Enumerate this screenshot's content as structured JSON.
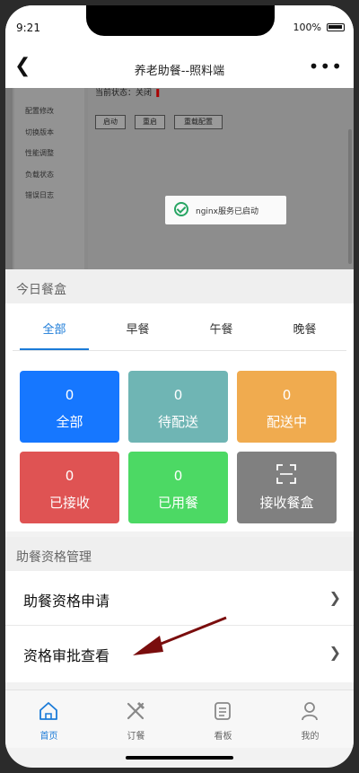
{
  "status_bar": {
    "time": "9:21",
    "battery": "100%"
  },
  "nav": {
    "title": "养老助餐--照料端"
  },
  "embedded_screenshot": {
    "side_menu": [
      "配置修改",
      "切换版本",
      "性能调整",
      "负载状态",
      "错误日志"
    ],
    "status_label": "当前状态：关闭",
    "buttons": [
      "启动",
      "重启",
      "重载配置"
    ],
    "toast": "nginx服务已启动"
  },
  "today_meals": {
    "section_title": "今日餐盒",
    "tabs": [
      "全部",
      "早餐",
      "午餐",
      "晚餐"
    ],
    "active_tab": "全部",
    "tiles": [
      {
        "count": "0",
        "label": "全部",
        "color": "#1677ff"
      },
      {
        "count": "0",
        "label": "待配送",
        "color": "#6fb5b4"
      },
      {
        "count": "0",
        "label": "配送中",
        "color": "#f0ab4f"
      },
      {
        "count": "0",
        "label": "已接收",
        "color": "#df5353"
      },
      {
        "count": "0",
        "label": "已用餐",
        "color": "#4cd964"
      },
      {
        "count": "",
        "label": "接收餐盒",
        "color": "#808080",
        "icon": "scan-icon"
      }
    ]
  },
  "qualification": {
    "section_title": "助餐资格管理",
    "items": [
      {
        "label": "助餐资格申请"
      },
      {
        "label": "资格审批查看"
      }
    ]
  },
  "tabbar": {
    "items": [
      {
        "label": "首页",
        "icon": "home-icon"
      },
      {
        "label": "订餐",
        "icon": "utensils-icon"
      },
      {
        "label": "看板",
        "icon": "board-icon"
      },
      {
        "label": "我的",
        "icon": "user-icon"
      }
    ],
    "active": "首页"
  },
  "colors": {
    "accent": "#1b7bd8"
  }
}
